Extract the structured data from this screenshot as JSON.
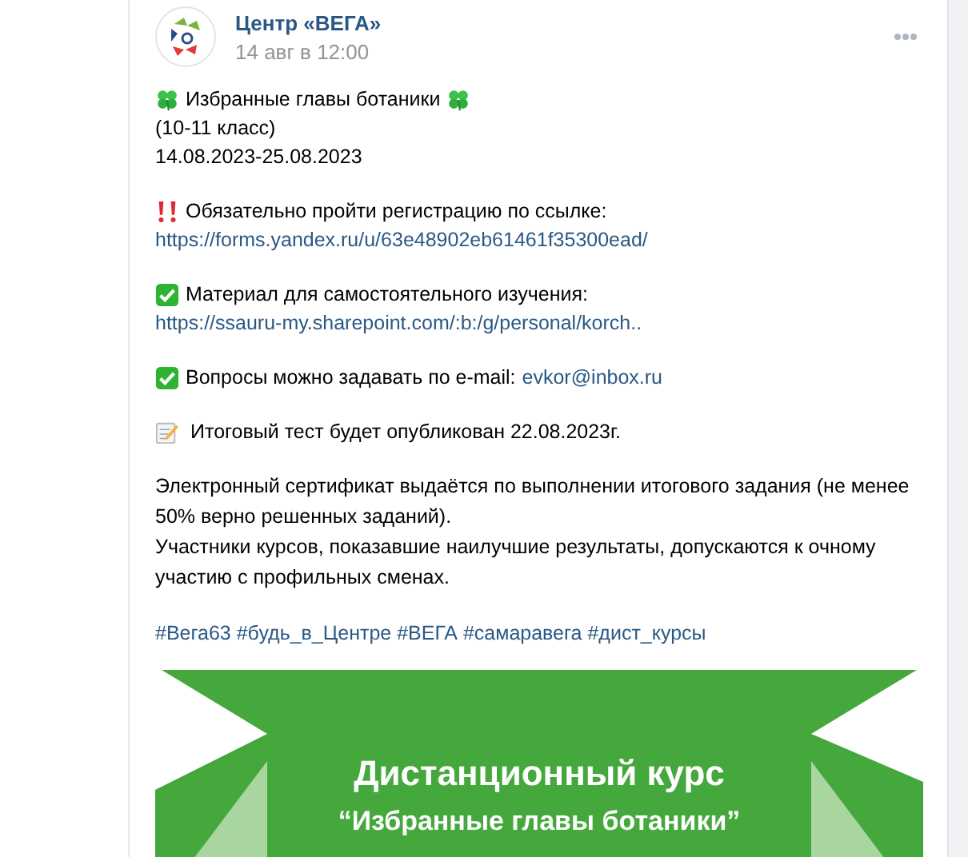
{
  "post": {
    "author": "Центр «ВЕГА»",
    "time": "14 авг в 12:00",
    "blocks": [
      {
        "lines": [
          {
            "kind": "title",
            "text": "Избранные главы ботаники"
          },
          {
            "kind": "plain",
            "text": "(10-11 класс)"
          },
          {
            "kind": "plain",
            "text": "14.08.2023-25.08.2023"
          }
        ]
      },
      {
        "lines": [
          {
            "kind": "alert",
            "text": "Обязательно пройти регистрацию по ссылке:"
          },
          {
            "kind": "link",
            "text": "https://forms.yandex.ru/u/63e48902eb61461f35300ead/"
          }
        ]
      },
      {
        "lines": [
          {
            "kind": "check",
            "text": "Материал для самостоятельного изучения:"
          },
          {
            "kind": "link",
            "text": "https://ssauru-my.sharepoint.com/:b:/g/personal/korch.."
          }
        ]
      },
      {
        "lines": [
          {
            "kind": "check",
            "text": "Вопросы можно задавать по e-mail:",
            "link": "evkor@inbox.ru"
          }
        ]
      },
      {
        "lines": [
          {
            "kind": "note",
            "text": "Итоговый тест будет опубликован 22.08.2023г."
          }
        ]
      },
      {
        "lines": [
          {
            "kind": "plain",
            "text": "Электронный сертификат выдаётся по выполнении итогового задания (не менее 50% верно решенных заданий)."
          },
          {
            "kind": "plain",
            "text": "Участники курсов, показавшие наилучшие результаты, допускаются к очному участию с профильных сменах."
          }
        ]
      },
      {
        "lines": [
          {
            "kind": "hashtags",
            "text": "#Вега63 #будь_в_Центре #ВЕГА #самаравега #дист_курсы"
          }
        ]
      }
    ],
    "banner": {
      "title": "Дистанционный курс",
      "subtitle": "“Избранные главы ботаники”"
    }
  }
}
